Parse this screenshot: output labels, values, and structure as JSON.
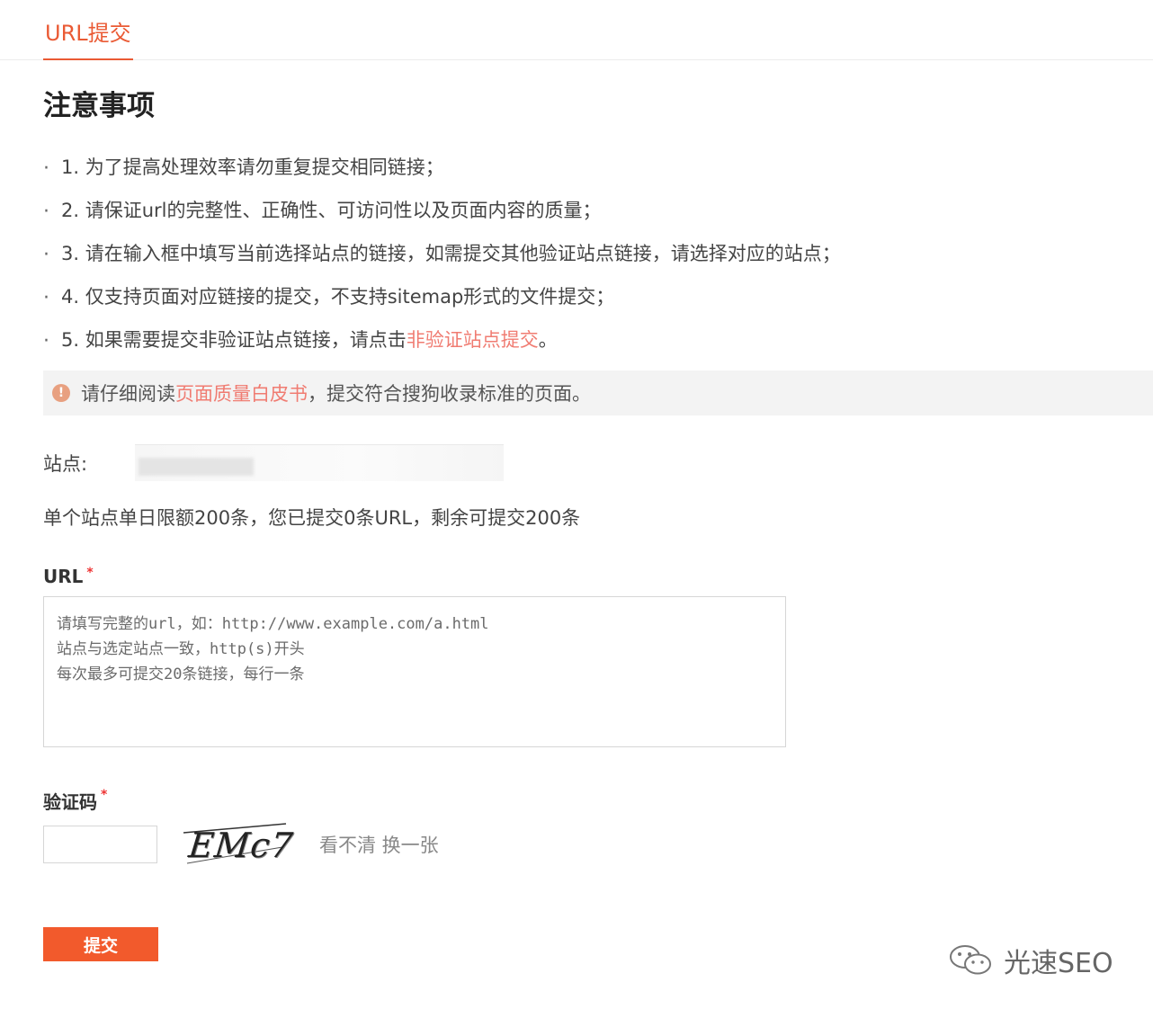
{
  "tabs": [
    {
      "label": "URL提交",
      "active": true
    }
  ],
  "heading": "注意事项",
  "notes": [
    {
      "text": "1. 为了提高处理效率请勿重复提交相同链接；",
      "link": ""
    },
    {
      "text": "2. 请保证url的完整性、正确性、可访问性以及页面内容的质量；",
      "link": ""
    },
    {
      "text": "3. 请在输入框中填写当前选择站点的链接，如需提交其他验证站点链接，请选择对应的站点；",
      "link": ""
    },
    {
      "text": "4. 仅支持页面对应链接的提交，不支持sitemap形式的文件提交；",
      "link": ""
    },
    {
      "text": "5. 如果需要提交非验证站点链接，请点击",
      "link": "非验证站点提交",
      "suffix": "。"
    }
  ],
  "alert": {
    "icon": "info-icon",
    "prefix": "请仔细阅读",
    "link": "页面质量白皮书",
    "suffix": "，提交符合搜狗收录标准的页面。"
  },
  "site": {
    "label": "站点:",
    "value": ""
  },
  "quota_text": "单个站点单日限额200条，您已提交0条URL，剩余可提交200条",
  "url_field": {
    "label": "URL",
    "required_mark": "*",
    "value": "",
    "placeholder": "请填写完整的url，如：http://www.example.com/a.html\n站点与选定站点一致，http(s)开头\n每次最多可提交20条链接，每行一条"
  },
  "captcha_field": {
    "label": "验证码",
    "required_mark": "*",
    "value": "",
    "image_text": "EMc7",
    "refresh_label": "看不清 换一张"
  },
  "submit_label": "提交",
  "watermark": {
    "icon": "wechat-icon",
    "text": "光速SEO"
  },
  "colors": {
    "accent": "#ea5a34",
    "submit": "#f25a2c",
    "link": "#f07c72",
    "required": "#e33333"
  }
}
